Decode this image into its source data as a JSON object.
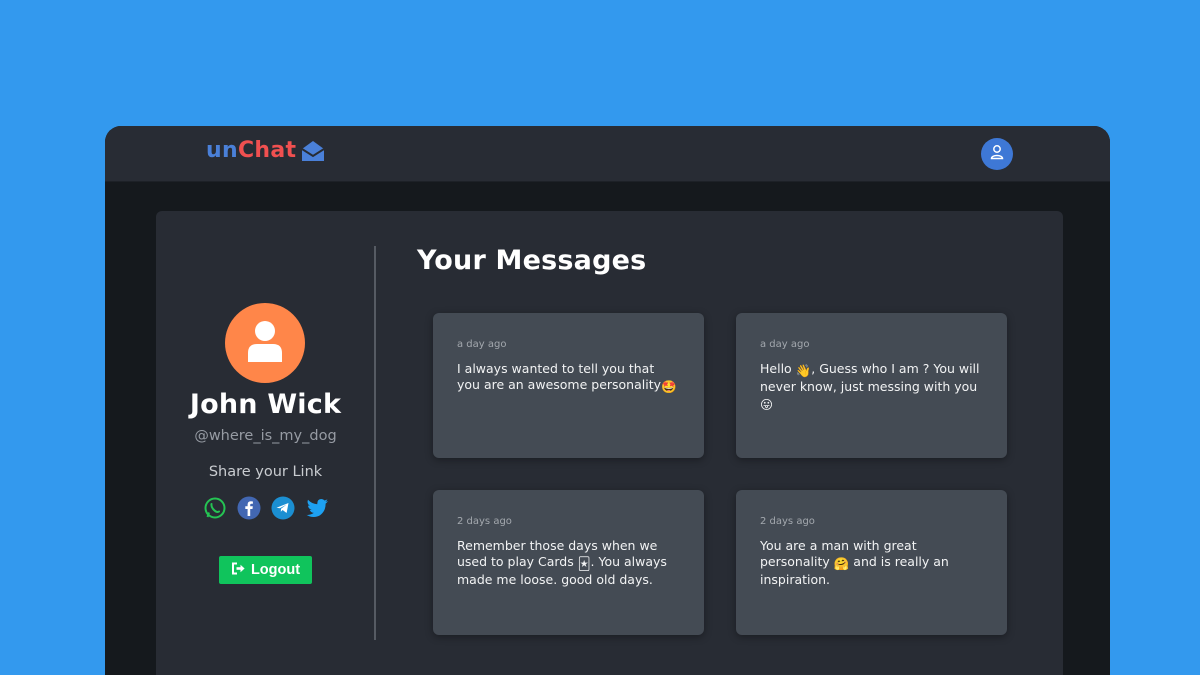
{
  "header": {
    "logo_part1": "un",
    "logo_part2": "Chat",
    "logo_icon": "envelope-open-icon",
    "profile_button_icon": "user-icon"
  },
  "profile": {
    "avatar_icon": "user-icon",
    "name": "John Wick",
    "handle": "@where_is_my_dog",
    "share_label": "Share your Link",
    "share_icons": [
      "whatsapp-icon",
      "facebook-icon",
      "telegram-icon",
      "twitter-icon"
    ],
    "logout_label": "Logout",
    "logout_icon": "sign-out-icon"
  },
  "messages": {
    "title": "Your Messages",
    "items": [
      {
        "time": "a day ago",
        "text": "I always wanted to tell you that you are an awesome personality",
        "emoji": "🤩"
      },
      {
        "time": "a day ago",
        "text_before": "Hello ",
        "emoji_inline": "👋",
        "text": ", Guess who I am ? You will never know, just messing with you ",
        "emoji": "😛"
      },
      {
        "time": "2 days ago",
        "text_before": "Remember those days when we used to play Cards ",
        "emoji_inline": "🃏",
        "text": ". You always made me loose. good old days.",
        "emoji": ""
      },
      {
        "time": "2 days ago",
        "text_before": "You are a man with great personality ",
        "emoji_inline": "🤗",
        "text": " and is really an inspiration.",
        "emoji": ""
      }
    ]
  },
  "colors": {
    "background": "#3399ee",
    "logo_un": "#4a80d8",
    "logo_chat": "#f05050",
    "avatar": "#ff8649",
    "logout": "#10c45c"
  }
}
